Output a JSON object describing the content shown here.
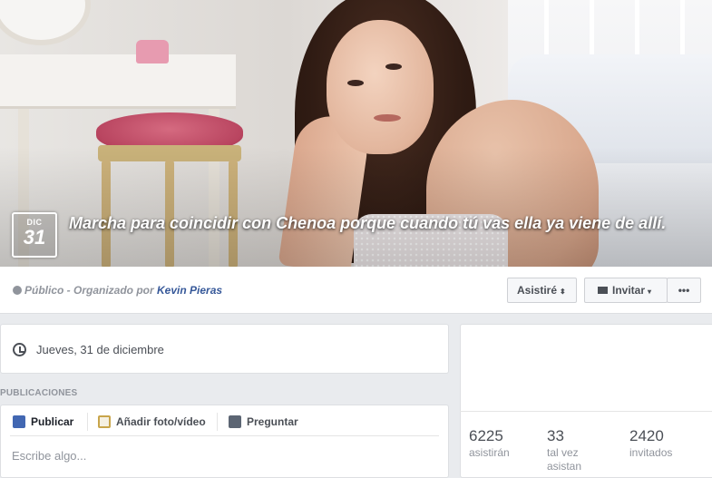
{
  "event": {
    "date_month": "DIC",
    "date_day": "31",
    "title": "Marcha para coincidir con Chenoa porque cuando tú vas ella ya viene de allí.",
    "privacy": "Público",
    "organized_by_prefix": " - Organizado por ",
    "organizer": "Kevin Pieras"
  },
  "actions": {
    "attend_label": "Asistiré",
    "attend_caret": "⬍",
    "invite_label": "Invitar",
    "invite_caret": "▾",
    "more_label": "•••"
  },
  "details": {
    "date_text": "Jueves, 31 de diciembre"
  },
  "posts": {
    "section_label": "PUBLICACIONES",
    "tabs": {
      "publish": "Publicar",
      "photo_video": "Añadir foto/vídeo",
      "ask": "Preguntar"
    },
    "input_placeholder": "Escribe algo..."
  },
  "stats": {
    "going_count": "6225",
    "going_label": "asistirán",
    "maybe_count": "33",
    "maybe_label_1": "tal vez",
    "maybe_label_2": "asistan",
    "invited_count": "2420",
    "invited_label": "invitados"
  },
  "colors": {
    "link": "#365899",
    "muted": "#90949c",
    "page_bg": "#e9ebee"
  },
  "icons": {
    "privacy": "globe-icon",
    "date": "clock-icon",
    "invite": "envelope-icon",
    "publish": "pencil-icon",
    "photo": "photo-icon",
    "ask": "question-list-icon"
  }
}
